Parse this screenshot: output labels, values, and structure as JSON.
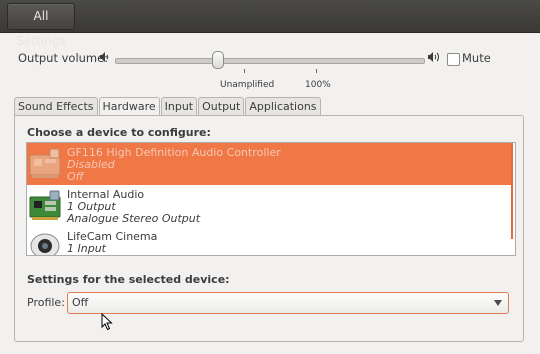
{
  "header": {
    "all_settings_label": "All Settings"
  },
  "volume": {
    "label": "Output volume:",
    "level_fraction": 0.33,
    "ticks": {
      "unamplified": "Unamplified",
      "hundred": "100%"
    },
    "mute_label": "Mute",
    "mute_checked": false
  },
  "tabs": [
    "Sound Effects",
    "Hardware",
    "Input",
    "Output",
    "Applications"
  ],
  "active_tab": "Hardware",
  "devices_section": {
    "title": "Choose a device to configure:",
    "items": [
      {
        "name": "GF116 High Definition Audio Controller",
        "line2": "Disabled",
        "line3": "Off",
        "icon": "sound-card-icon",
        "selected": true
      },
      {
        "name": "Internal Audio",
        "line2": "1 Output",
        "line3": "Analogue Stereo Output",
        "icon": "sound-card-icon",
        "selected": false
      },
      {
        "name": "LifeCam Cinema",
        "line2": "1 Input",
        "line3": "",
        "icon": "webcam-icon",
        "selected": false
      }
    ]
  },
  "settings_section": {
    "title": "Settings for the selected device:",
    "profile_label": "Profile:",
    "profile_value": "Off"
  },
  "colors": {
    "selection": "#f07746",
    "titlebar": "#3c3b37",
    "window_bg": "#f2f1f0",
    "focus_border": "#e47c52"
  }
}
